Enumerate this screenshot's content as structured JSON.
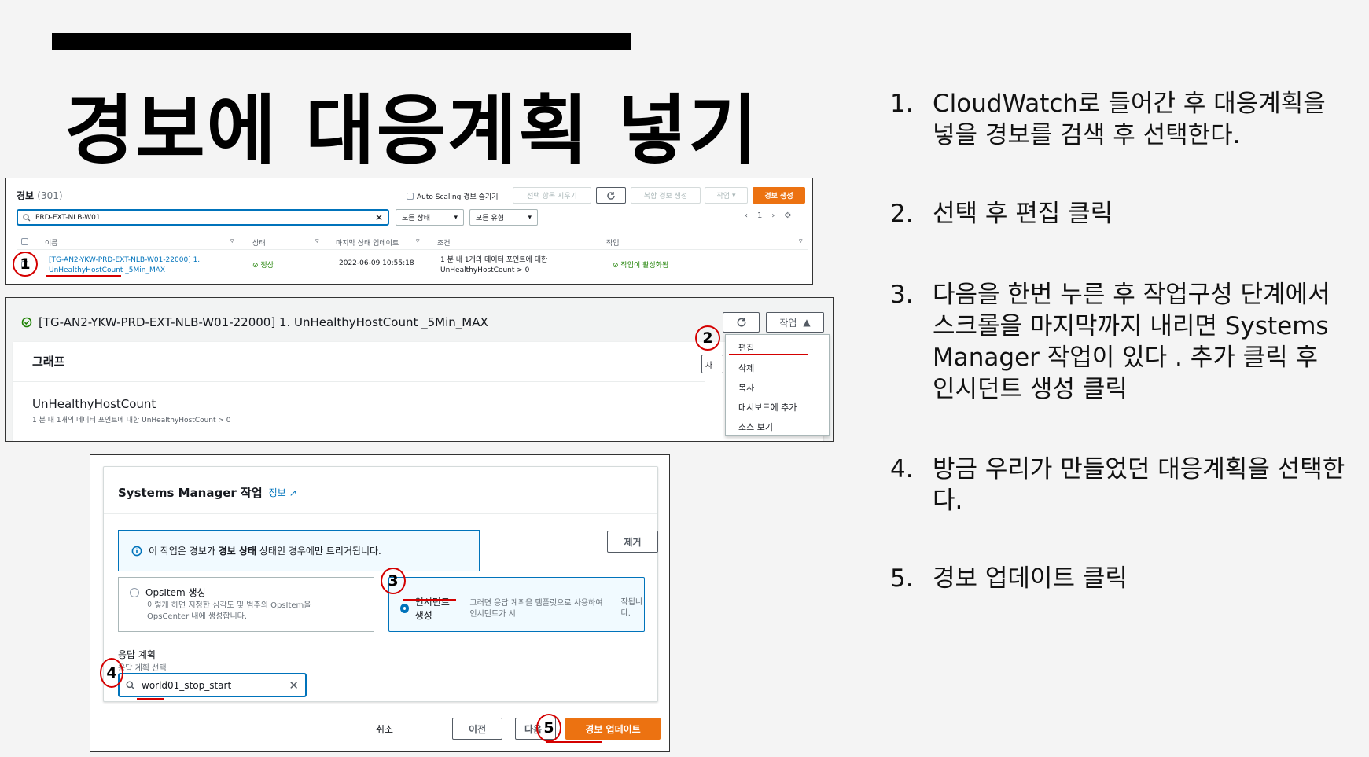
{
  "slide": {
    "title": "경보에 대응계획 넣기",
    "steps": [
      {
        "num": "1.",
        "text": "CloudWatch로 들어간 후 대응계획을 넣을 경보를 검색 후  선택한다."
      },
      {
        "num": "2.",
        "text": "선택 후 편집 클릭"
      },
      {
        "num": "3.",
        "text": "다음을 한번 누른 후 작업구성 단계에서 스크롤을 마지막까지 내리면 Systems Manager 작업이 있다 . 추가 클릭 후 인시던트 생성 클릭"
      },
      {
        "num": "4.",
        "text": "방금 우리가 만들었던 대응계획을 선택한다."
      },
      {
        "num": "5.",
        "text": "경보 업데이트 클릭"
      }
    ]
  },
  "alarms_list": {
    "heading": "경보",
    "count": "(301)",
    "auto_scaling_label": "Auto Scaling 경보 숨기기",
    "clear_selection": "선택 항목 지우기",
    "composite_alarm": "복합 경보 생성",
    "actions": "작업",
    "create_alarm": "경보 생성",
    "search_value": "PRD-EXT-NLB-W01",
    "state_filter": "모든 상태",
    "type_filter": "모든 유형",
    "page": "1",
    "columns": [
      "이름",
      "상태",
      "마지막 상태 업데이트",
      "조건",
      "작업"
    ],
    "row": {
      "name_line1": "[TG-AN2-YKW-PRD-EXT-NLB-W01-22000] 1.",
      "name_line2": "UnHealthyHostCount _5Min_MAX",
      "state": "정상",
      "updated": "2022-06-09 10:55:18",
      "condition_line1": "1 분 내 1개의 데이터 포인트에 대한",
      "condition_line2": "UnHealthyHostCount > 0",
      "action_status": "작업이 활성화됨"
    }
  },
  "alarm_detail": {
    "title": "[TG-AN2-YKW-PRD-EXT-NLB-W01-22000] 1. UnHealthyHostCount _5Min_MAX",
    "graph_heading": "그래프",
    "metric": "UnHealthyHostCount",
    "metric_condition": "1 분 내 1개의 데이터 포인트에 대한 UnHealthyHostCount > 0",
    "actions_button": "작업",
    "stub_label": "자",
    "menu": [
      "편집",
      "삭제",
      "복사",
      "대시보드에 추가",
      "소스 보기"
    ]
  },
  "ssm_action": {
    "title": "Systems Manager 작업",
    "info": "정보",
    "alert_prefix": "이 작업은 경보가 ",
    "alert_bold": "경보 상태",
    "alert_suffix": " 상태인 경우에만 트리거됩니다.",
    "remove": "제거",
    "option_opsitem_title": "OpsItem 생성",
    "option_opsitem_desc1": "이렇게 하면 지정한 심각도 및 범주의 OpsItem을",
    "option_opsitem_desc2": "OpsCenter 내에 생성합니다.",
    "option_incident_title": "인시던트 생성",
    "option_incident_desc1": "그러면 응답 계획을 템플릿으로 사용하여 인시던트가 시",
    "option_incident_desc2": "작됩니다.",
    "response_plan_label": "응답 계획",
    "response_plan_desc": "응답 계획 선택",
    "response_plan_value": "world01_stop_start",
    "cancel": "취소",
    "previous": "이전",
    "next": "다음",
    "update_alarm": "경보 업데이트"
  },
  "annotations": [
    "1",
    "2",
    "3",
    "4",
    "5"
  ],
  "colors": {
    "accent": "#ec7211",
    "link": "#0073bb",
    "ok": "#1d8102",
    "annotation": "#d40000"
  }
}
